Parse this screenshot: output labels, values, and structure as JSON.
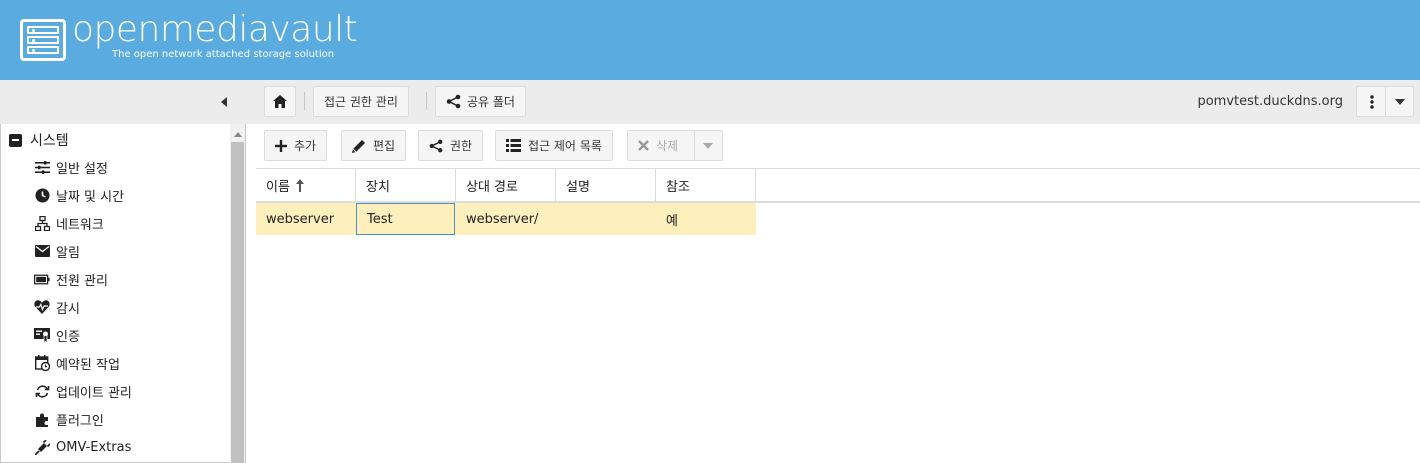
{
  "app": {
    "logo_name": "openmediavault",
    "tagline": "The open network attached storage solution"
  },
  "colors": {
    "header_bg": "#5aabdf",
    "toolbar_bg": "#ececec",
    "row_selected_bg": "#fdf0bd",
    "focus_border": "#4a90c8"
  },
  "breadcrumb": {
    "home_icon": "home-icon",
    "items": [
      {
        "label": "접근 권한 관리"
      },
      {
        "label": "공유 폴더",
        "icon": "share-icon"
      }
    ]
  },
  "hostname": "pomvtest.duckdns.org",
  "sidebar": {
    "root": {
      "label": "시스템",
      "icon": "minus-square-icon"
    },
    "items": [
      {
        "label": "일반 설정",
        "icon": "sliders-icon"
      },
      {
        "label": "날짜 및 시간",
        "icon": "clock-icon"
      },
      {
        "label": "네트워크",
        "icon": "network-icon"
      },
      {
        "label": "알림",
        "icon": "envelope-icon"
      },
      {
        "label": "전원 관리",
        "icon": "battery-icon"
      },
      {
        "label": "감시",
        "icon": "heartbeat-icon"
      },
      {
        "label": "인증",
        "icon": "certificate-icon"
      },
      {
        "label": "예약된 작업",
        "icon": "calendar-clock-icon"
      },
      {
        "label": "업데이트 관리",
        "icon": "sync-icon"
      },
      {
        "label": "플러그인",
        "icon": "puzzle-icon"
      },
      {
        "label": "OMV-Extras",
        "icon": "plug-icon"
      }
    ]
  },
  "actions": {
    "add": "추가",
    "edit": "편집",
    "privileges": "권한",
    "acl": "접근 제어 목록",
    "delete": "삭제"
  },
  "grid": {
    "columns": [
      "이름",
      "장치",
      "상대 경로",
      "설명",
      "참조"
    ],
    "sort": {
      "column": "이름",
      "direction": "ascending"
    },
    "rows": [
      {
        "name": "webserver",
        "device": "Test",
        "path": "webserver/",
        "description": "",
        "referenced": "예"
      }
    ]
  }
}
